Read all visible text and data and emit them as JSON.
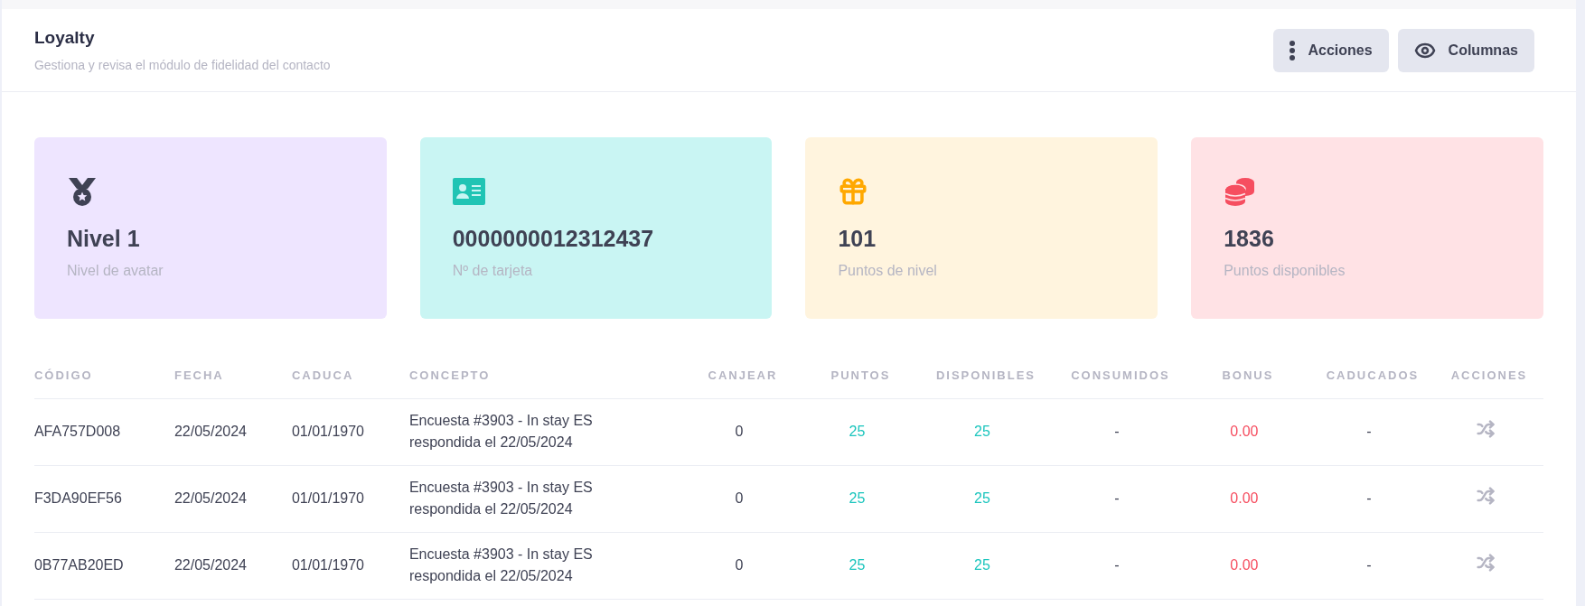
{
  "header": {
    "title": "Loyalty",
    "subtitle": "Gestiona y revisa el módulo de fidelidad del contacto",
    "buttons": [
      {
        "kind": "menu",
        "label": "Acciones"
      },
      {
        "kind": "view",
        "label": "Columnas"
      }
    ]
  },
  "stats": [
    {
      "kind": "medal",
      "value": "Nivel 1",
      "label": "Nivel de avatar",
      "color": "#3f4254"
    },
    {
      "kind": "card",
      "value": "0000000012312437",
      "label": "Nº de tarjeta",
      "color": "#20c4b4"
    },
    {
      "kind": "gift",
      "value": "101",
      "label": "Puntos de nivel",
      "color": "#ffa800"
    },
    {
      "kind": "coins",
      "value": "1836",
      "label": "Puntos disponibles",
      "color": "#f64e60"
    }
  ],
  "table": {
    "columns": [
      {
        "label": "CÓDIGO",
        "kind": "text"
      },
      {
        "label": "FECHA",
        "kind": "text"
      },
      {
        "label": "CADUCA",
        "kind": "text"
      },
      {
        "label": "CONCEPTO",
        "kind": "text"
      },
      {
        "label": "CANJEAR",
        "kind": "number"
      },
      {
        "label": "PUNTOS",
        "kind": "positive"
      },
      {
        "label": "DISPONIBLES",
        "kind": "positive"
      },
      {
        "label": "CONSUMIDOS",
        "kind": "number"
      },
      {
        "label": "BONUS",
        "kind": "negative"
      },
      {
        "label": "CADUCADOS",
        "kind": "number"
      },
      {
        "label": "ACCIONES",
        "kind": "action"
      }
    ],
    "rows": [
      {
        "cells": [
          "AFA757D008",
          "22/05/2024",
          "01/01/1970",
          "Encuesta #3903 - In stay ES respondida el 22/05/2024",
          "0",
          "25",
          "25",
          "-",
          "0.00",
          "-",
          ""
        ]
      },
      {
        "cells": [
          "F3DA90EF56",
          "22/05/2024",
          "01/01/1970",
          "Encuesta #3903 - In stay ES respondida el 22/05/2024",
          "0",
          "25",
          "25",
          "-",
          "0.00",
          "-",
          ""
        ]
      },
      {
        "cells": [
          "0B77AB20ED",
          "22/05/2024",
          "01/01/1970",
          "Encuesta #3903 - In stay ES respondida el 22/05/2024",
          "0",
          "25",
          "25",
          "-",
          "0.00",
          "-",
          ""
        ]
      }
    ]
  }
}
